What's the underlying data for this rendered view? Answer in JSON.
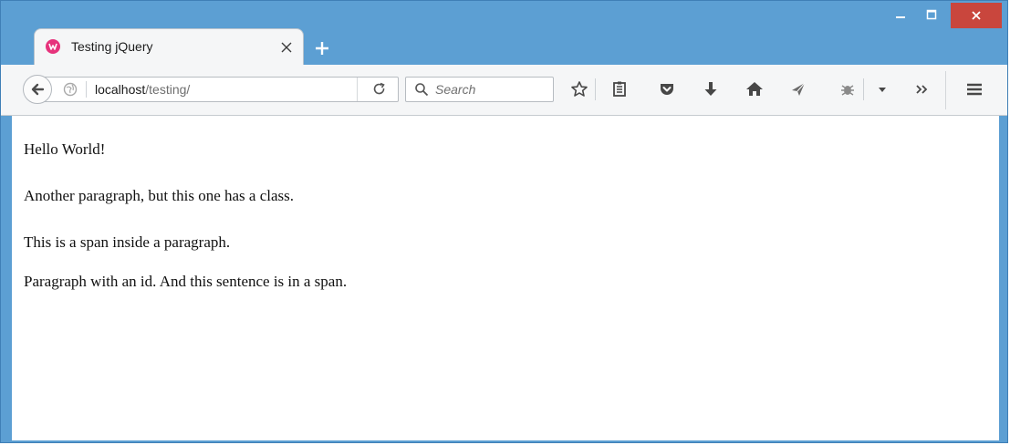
{
  "window": {
    "controls": {
      "minimize_icon": "minimize-icon",
      "maximize_icon": "maximize-icon",
      "close_icon": "close-icon",
      "close_color": "#c9463d"
    },
    "frame_color": "#5c9fd3"
  },
  "tab": {
    "title": "Testing jQuery",
    "favicon_icon": "webmatrix-favicon-icon",
    "favicon_color": "#e6337c",
    "close_icon": "tab-close-icon",
    "new_tab_icon": "plus-icon"
  },
  "navbar": {
    "back_icon": "back-arrow-icon",
    "site_icon": "globe-icon",
    "url": {
      "host": "localhost",
      "path": "/testing/"
    },
    "reload_icon": "reload-icon",
    "search": {
      "placeholder": "Search",
      "icon": "magnifier-icon"
    },
    "toolbar_icons": [
      "bookmark-star-icon",
      "reading-list-icon",
      "pocket-icon",
      "download-arrow-icon",
      "home-icon",
      "share-send-icon",
      "extension-bug-icon",
      "dropdown-caret-icon",
      "overflow-chevron-icon",
      "hamburger-menu-icon"
    ]
  },
  "page": {
    "paragraphs": [
      "Hello World!",
      "Another paragraph, but this one has a class.",
      "This is a span inside a paragraph.",
      "Paragraph with an id. And this sentence is in a span."
    ]
  }
}
